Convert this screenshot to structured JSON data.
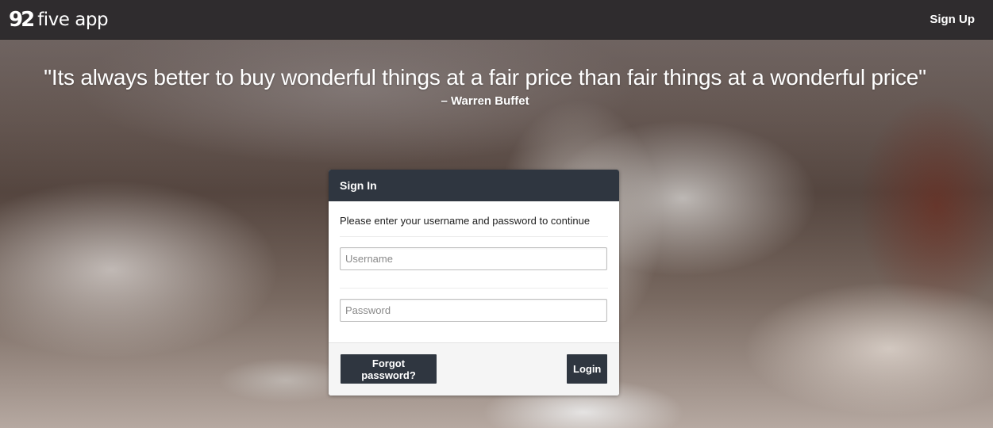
{
  "navbar": {
    "brand_mark": "92",
    "brand_text": "five app",
    "signup_label": "Sign Up"
  },
  "hero": {
    "quote": "\"Its always better to buy wonderful things at a fair price than fair things at a wonderful price\"",
    "author": "– Warren Buffet"
  },
  "signin": {
    "title": "Sign In",
    "instructions": "Please enter your username and password to continue",
    "username_placeholder": "Username",
    "password_placeholder": "Password",
    "forgot_label": "Forgot password?",
    "login_label": "Login"
  },
  "colors": {
    "navbar_bg": "#2f2c2e",
    "panel_header_bg": "#2f3640",
    "button_bg": "#2f3640"
  }
}
